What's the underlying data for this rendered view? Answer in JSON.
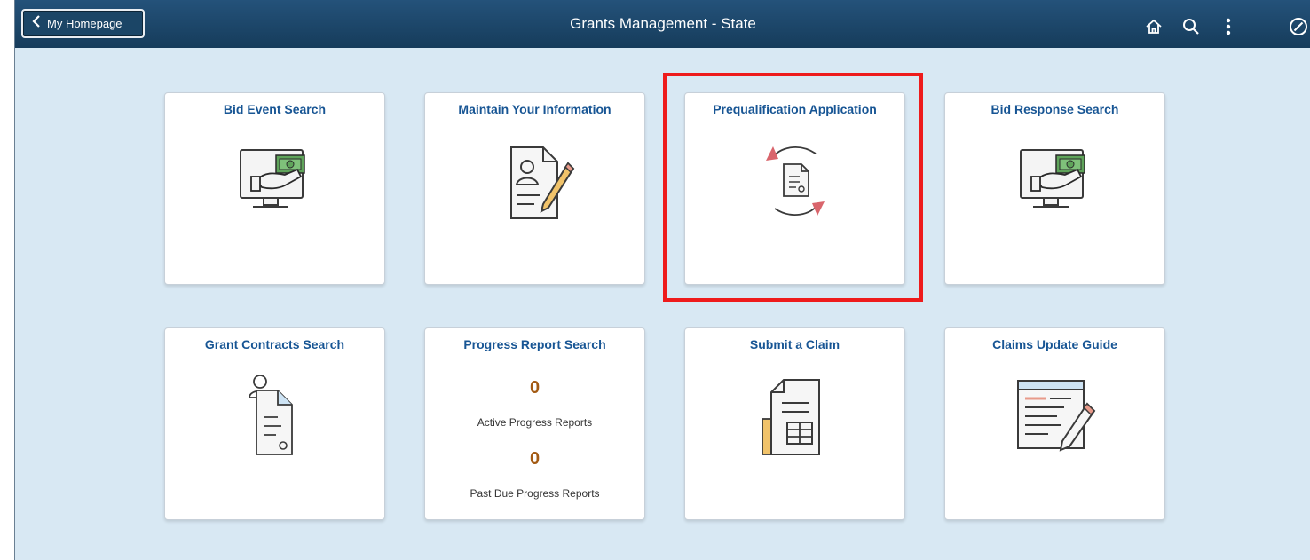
{
  "banner": {
    "back_label": "My Homepage",
    "title": "Grants Management - State"
  },
  "toolbar": {
    "icons": [
      "home-icon",
      "search-icon",
      "actions-menu-icon",
      "navbar-icon"
    ]
  },
  "tiles": [
    {
      "title": "Bid Event Search",
      "icon": "monitor-payment-icon"
    },
    {
      "title": "Maintain Your Information",
      "icon": "profile-edit-icon"
    },
    {
      "title": "Prequalification Application",
      "icon": "document-cycle-icon",
      "highlighted": true
    },
    {
      "title": "Bid Response Search",
      "icon": "monitor-payment-icon"
    },
    {
      "title": "Grant Contracts Search",
      "icon": "user-document-icon"
    },
    {
      "title": "Progress Report Search",
      "counts": [
        {
          "value": "0",
          "label": "Active Progress Reports"
        },
        {
          "value": "0",
          "label": "Past Due Progress Reports"
        }
      ]
    },
    {
      "title": "Submit a Claim",
      "icon": "claim-form-icon"
    },
    {
      "title": "Claims Update Guide",
      "icon": "guide-edit-icon"
    }
  ],
  "colors": {
    "banner": "#1d4a6e",
    "background": "#d8e8f3",
    "tile_title": "#175594",
    "count": "#a35a13",
    "highlight": "#ee1b1b"
  }
}
